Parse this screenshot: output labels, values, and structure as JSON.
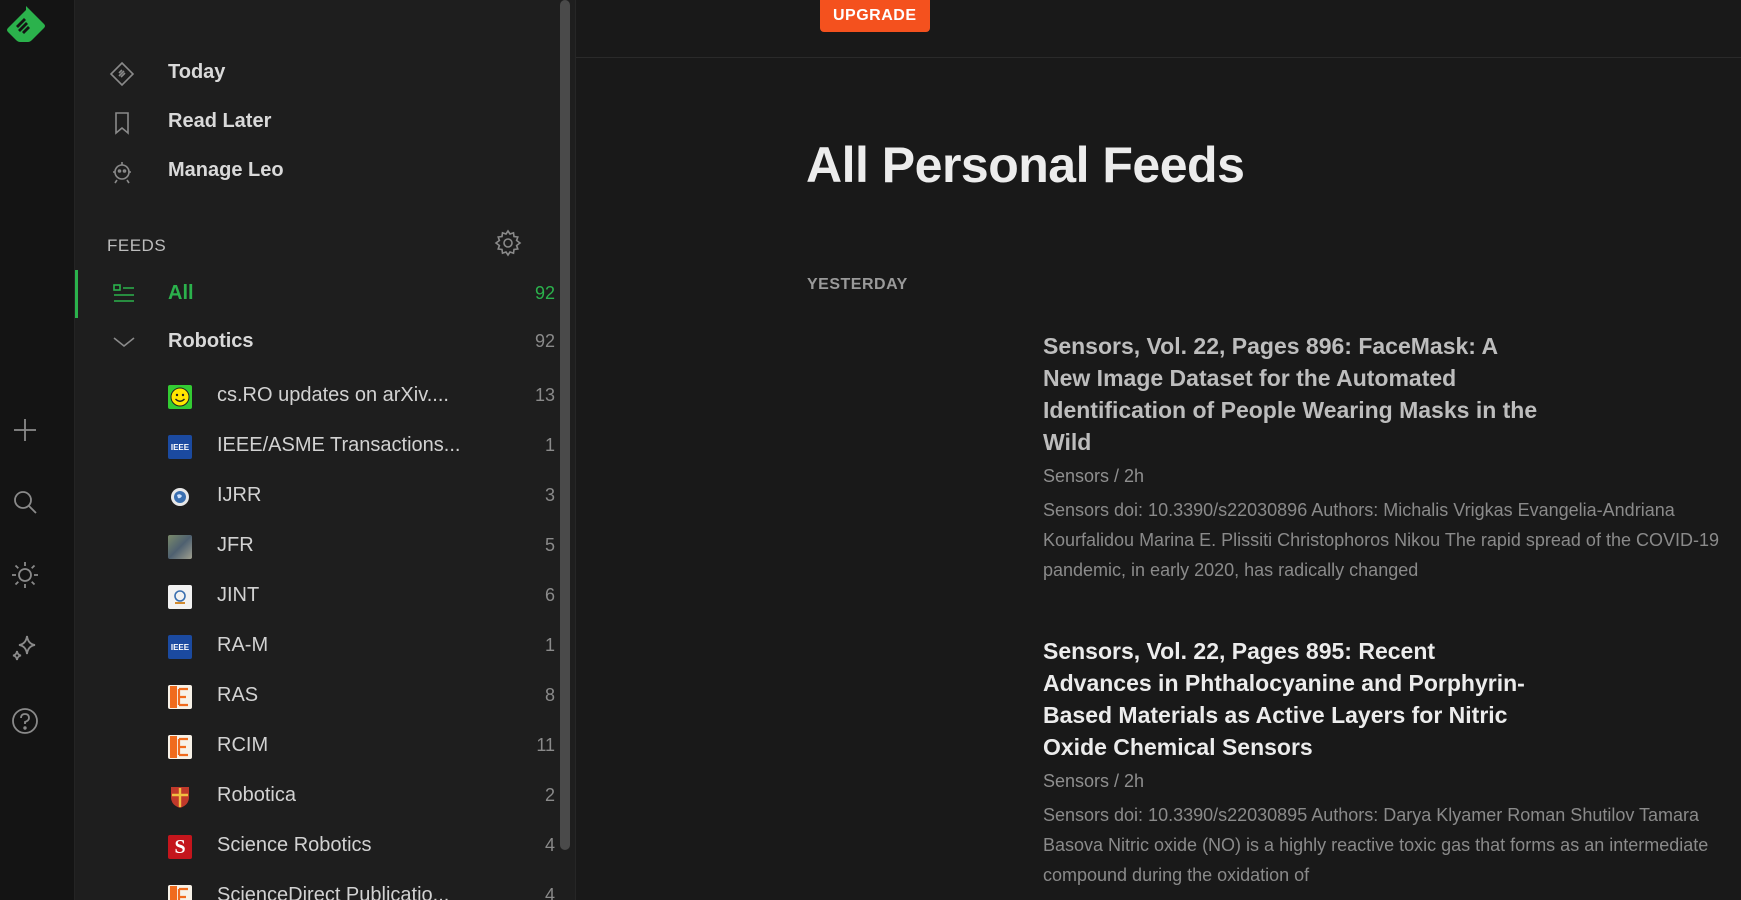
{
  "sidebar": {
    "nav": [
      {
        "label": "Today",
        "icon": "today-icon"
      },
      {
        "label": "Read Later",
        "icon": "bookmark-icon"
      },
      {
        "label": "Manage Leo",
        "icon": "leo-robot-icon"
      }
    ],
    "section_title": "FEEDS",
    "all": {
      "label": "All",
      "count": "92"
    },
    "group": {
      "label": "Robotics",
      "count": "92"
    },
    "feeds": [
      {
        "label": "cs.RO updates on arXiv....",
        "count": "13",
        "icon": "arxiv-smiley-icon"
      },
      {
        "label": "IEEE/ASME Transactions...",
        "count": "1",
        "icon": "ieee-icon"
      },
      {
        "label": "IJRR",
        "count": "3",
        "icon": "ijrr-globe-icon"
      },
      {
        "label": "JFR",
        "count": "5",
        "icon": "jfr-thumbnail-icon"
      },
      {
        "label": "JINT",
        "count": "6",
        "icon": "jint-logo-icon"
      },
      {
        "label": "RA-M",
        "count": "1",
        "icon": "ieee-icon"
      },
      {
        "label": "RAS",
        "count": "8",
        "icon": "elsevier-icon"
      },
      {
        "label": "RCIM",
        "count": "11",
        "icon": "elsevier-icon"
      },
      {
        "label": "Robotica",
        "count": "2",
        "icon": "cambridge-shield-icon"
      },
      {
        "label": "Science Robotics",
        "count": "4",
        "icon": "science-s-icon"
      },
      {
        "label": "ScienceDirect Publicatio...",
        "count": "4",
        "icon": "elsevier-icon"
      }
    ]
  },
  "rail": {
    "icons": [
      "feedly-logo-icon",
      "add-icon",
      "search-icon",
      "theme-sun-icon",
      "sparkle-icon",
      "help-icon"
    ]
  },
  "main": {
    "upgrade_label": "UPGRADE",
    "title": "All Personal Feeds",
    "day_label": "YESTERDAY",
    "articles": [
      {
        "title": "Sensors, Vol. 22, Pages 896: FaceMask: A New Image Dataset for the Automated Identification of People Wearing Masks in the Wild",
        "meta": "Sensors / 2h",
        "summary": "Sensors doi: 10.3390/s22030896 Authors: Michalis Vrigkas Evangelia-Andriana Kourfalidou Marina E. Plissiti Christophoros Nikou The rapid spread of the COVID-19 pandemic, in early 2020, has radically changed"
      },
      {
        "title": "Sensors, Vol. 22, Pages 895: Recent Advances in Phthalocyanine and Porphyrin-Based Materials as Active Layers for Nitric Oxide Chemical Sensors",
        "meta": "Sensors / 2h",
        "summary": "Sensors doi: 10.3390/s22030895 Authors: Darya Klyamer Roman Shutilov Tamara Basova Nitric oxide (NO) is a highly reactive toxic gas that forms as an intermediate compound during the oxidation of"
      }
    ]
  },
  "colors": {
    "accent": "#2bb24c",
    "upgrade": "#f4511e",
    "background": "#191919",
    "sidebar": "#1e1e1e"
  }
}
